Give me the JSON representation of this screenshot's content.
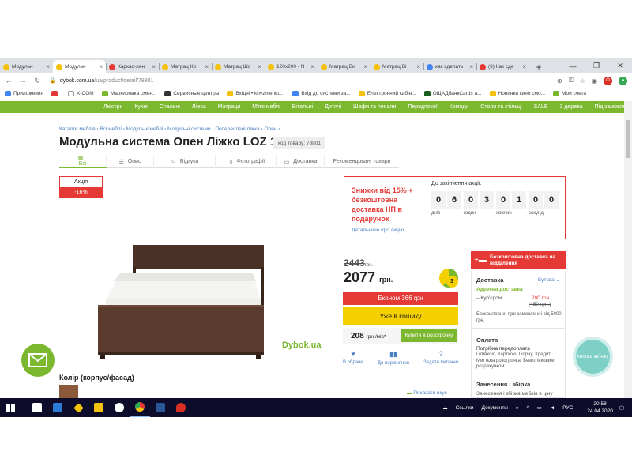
{
  "browser": {
    "tabs": [
      {
        "title": "Модульн",
        "color": "#f4c20d",
        "active": false
      },
      {
        "title": "Модульн",
        "color": "#f4c20d",
        "active": true
      },
      {
        "title": "Каркас-лен",
        "color": "#e53935",
        "active": false
      },
      {
        "title": "Матрац Ко",
        "color": "#f4c20d",
        "active": false
      },
      {
        "title": "Матрац Шо",
        "color": "#f4c20d",
        "active": false
      },
      {
        "title": "120x200 - N",
        "color": "#f4c20d",
        "active": false
      },
      {
        "title": "Матрац Ви",
        "color": "#f4c20d",
        "active": false
      },
      {
        "title": "Матрац Ві",
        "color": "#f4c20d",
        "active": false
      },
      {
        "title": "как сделать",
        "color": "#4285f4",
        "active": false
      },
      {
        "title": "(3) Как сде",
        "color": "#e53935",
        "active": false
      }
    ],
    "new_tab": "+",
    "win_min": "—",
    "win_max": "❐",
    "win_close": "✕",
    "url_host": "dybok.com.ua",
    "url_path": "/ua/product/detail/78801",
    "bookmarks": [
      {
        "label": "Приложения",
        "color": "#4285f4"
      },
      {
        "label": "",
        "color": "#e53935"
      },
      {
        "label": "X-COM",
        "color": "#ffffff"
      },
      {
        "label": "Маркировка смен...",
        "color": "#7cb82f"
      },
      {
        "label": "Сервисные центры",
        "color": "#333333"
      },
      {
        "label": "Вхідні • khyzmenko...",
        "color": "#f4c20d"
      },
      {
        "label": "Вхід до системи за...",
        "color": "#4285f4"
      },
      {
        "label": "Електронний кабін...",
        "color": "#f4c20d"
      },
      {
        "label": "ОЩАДбанкCards a...",
        "color": "#1b5e20"
      },
      {
        "label": "Новинки кино смо...",
        "color": "#f4c20d"
      },
      {
        "label": "Мои счета",
        "color": "#7cb82f"
      }
    ]
  },
  "site_nav": [
    "Люстри",
    "Кухні",
    "Спальні",
    "Ліжка",
    "Матраци",
    "М'які меблі",
    "Вітальні",
    "Дитячі",
    "Шафи та пенали",
    "Передпокої",
    "Комоди",
    "Столи та стільці",
    "SALE",
    "3 дерева",
    "Під замовлення"
  ],
  "product": {
    "breadcrumb": "Каталог меблів › Всі меблі › Модульні меблі › Модульні системи › Попереслені ліжка › Олен ›",
    "title": "Модульна система Опен Ліжко LOZ 120",
    "code": "код товару: 78801",
    "tabs": [
      {
        "label": "Всі",
        "icon": "▦"
      },
      {
        "label": "Опис",
        "icon": "☰"
      },
      {
        "label": "Відгуки",
        "icon": "☺"
      },
      {
        "label": "Фотографії",
        "icon": "◫"
      },
      {
        "label": "Доставка",
        "icon": "▭"
      },
      {
        "label": "Рекомендовані товари",
        "icon": ""
      }
    ],
    "akciya_label": "Акція",
    "discount": "-16%",
    "promo_text": "Знижки від 15% + безкоштовна доставка НП в подарунок",
    "promo_link": "Детальніше про акцію",
    "countdown_label": "До закінчення акції:",
    "countdown": [
      {
        "digits": [
          "0",
          "6"
        ],
        "label": "днів"
      },
      {
        "digits": [
          "0",
          "3"
        ],
        "label": "годин"
      },
      {
        "digits": [
          "0",
          "1"
        ],
        "label": "хвилин"
      },
      {
        "digits": [
          "0",
          "0"
        ],
        "label": "секунд"
      }
    ],
    "watermark": "Dybok.ua",
    "old_price": "2443",
    "old_price_unit": "грн.",
    "new_price": "2077",
    "new_price_unit": "грн.",
    "pie_number": "3",
    "econ_button": "Економ 366 грн",
    "cart_button": "Уже в кошику",
    "credit_price": "208",
    "credit_unit": "грн./міс*",
    "credit_button": "Купити в розстрочку",
    "actions": [
      {
        "icon": "♥",
        "label": "В обране"
      },
      {
        "icon": "▮▮",
        "label": "До порівняння"
      },
      {
        "icon": "?",
        "label": "Задати питання"
      }
    ],
    "show_size": "Показати вкус",
    "color_label": "Колір (корпус/фасад)"
  },
  "sidebar": {
    "free_delivery": "Безкоштовна доставка на відділення",
    "delivery_title": "Доставка",
    "city": "Бутєва",
    "address_delivery": "Адресна доставка",
    "courier": "Кур'єром",
    "courier_price": "200 грн.",
    "courier_old": "(450 грн.)",
    "free_note": "Безкоштовно: при замовленні від 5000 грн.",
    "payment_title": "Оплата",
    "payment_sub": "Потрібна передоплата",
    "payment_methods": "Готівкою, Карткою, Liqpay, Кредит, Миттєва розстрочка, Безготівковим розрахунком",
    "assembly_title": "Занесення і збірка",
    "assembly_text": "Занесення і збірка меблів в ціну"
  },
  "widgets": {
    "knopka": "Кнопка зв'язку"
  },
  "taskbar": {
    "tray_items": [
      "Ссылки",
      "Документы"
    ],
    "lang": "РУС",
    "time": "20:58",
    "date": "24.04.2020"
  }
}
